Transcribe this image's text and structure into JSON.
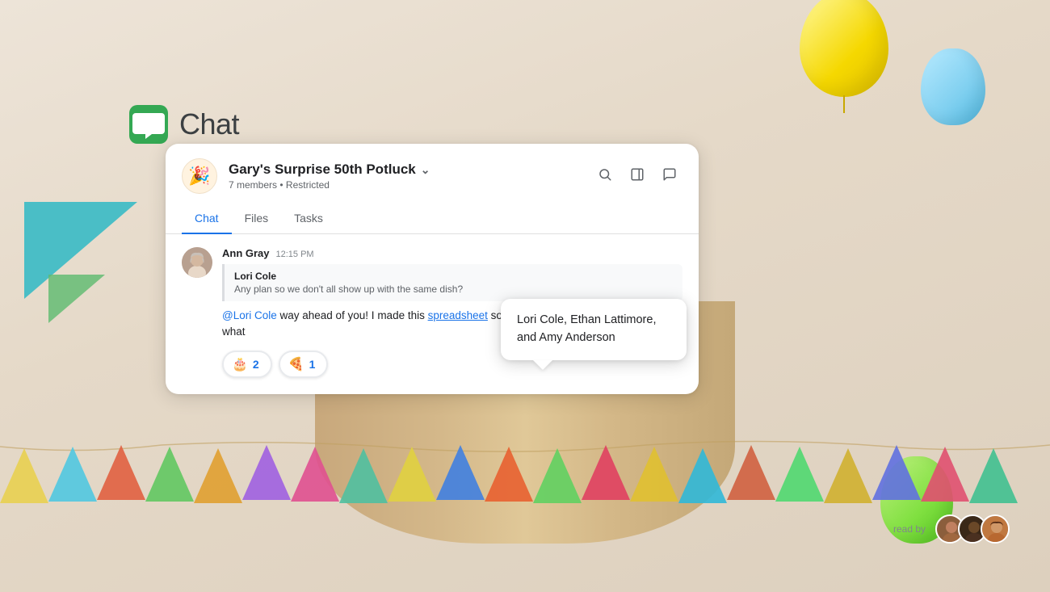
{
  "app": {
    "title": "Chat"
  },
  "card": {
    "group_name": "Gary's Surprise 50th Potluck",
    "group_avatar_emoji": "🎉",
    "member_count": "7 members",
    "restriction": "Restricted",
    "tabs": [
      {
        "label": "Chat",
        "active": true
      },
      {
        "label": "Files",
        "active": false
      },
      {
        "label": "Tasks",
        "active": false
      }
    ],
    "message": {
      "sender_name": "Ann Gray",
      "time": "12:15 PM",
      "quoted_sender": "Lori Cole",
      "quoted_text": "Any plan so we don't all show up with the same dish?",
      "text_part1": "@Lori Cole",
      "text_part2": " way ahead of you! I made this ",
      "text_link": "spreadsheet",
      "text_part3": " so we can sign up for who is bringing what"
    },
    "reactions": [
      {
        "emoji": "🎂",
        "count": "2"
      },
      {
        "emoji": "🍕",
        "count": "1"
      }
    ],
    "tooltip": {
      "text": "Lori Cole, Ethan Lattimore, and Amy Anderson"
    },
    "read_by_label": "read by"
  },
  "icons": {
    "search": "🔍",
    "panel": "⊟",
    "message_square": "💬",
    "chevron_down": "∨"
  }
}
